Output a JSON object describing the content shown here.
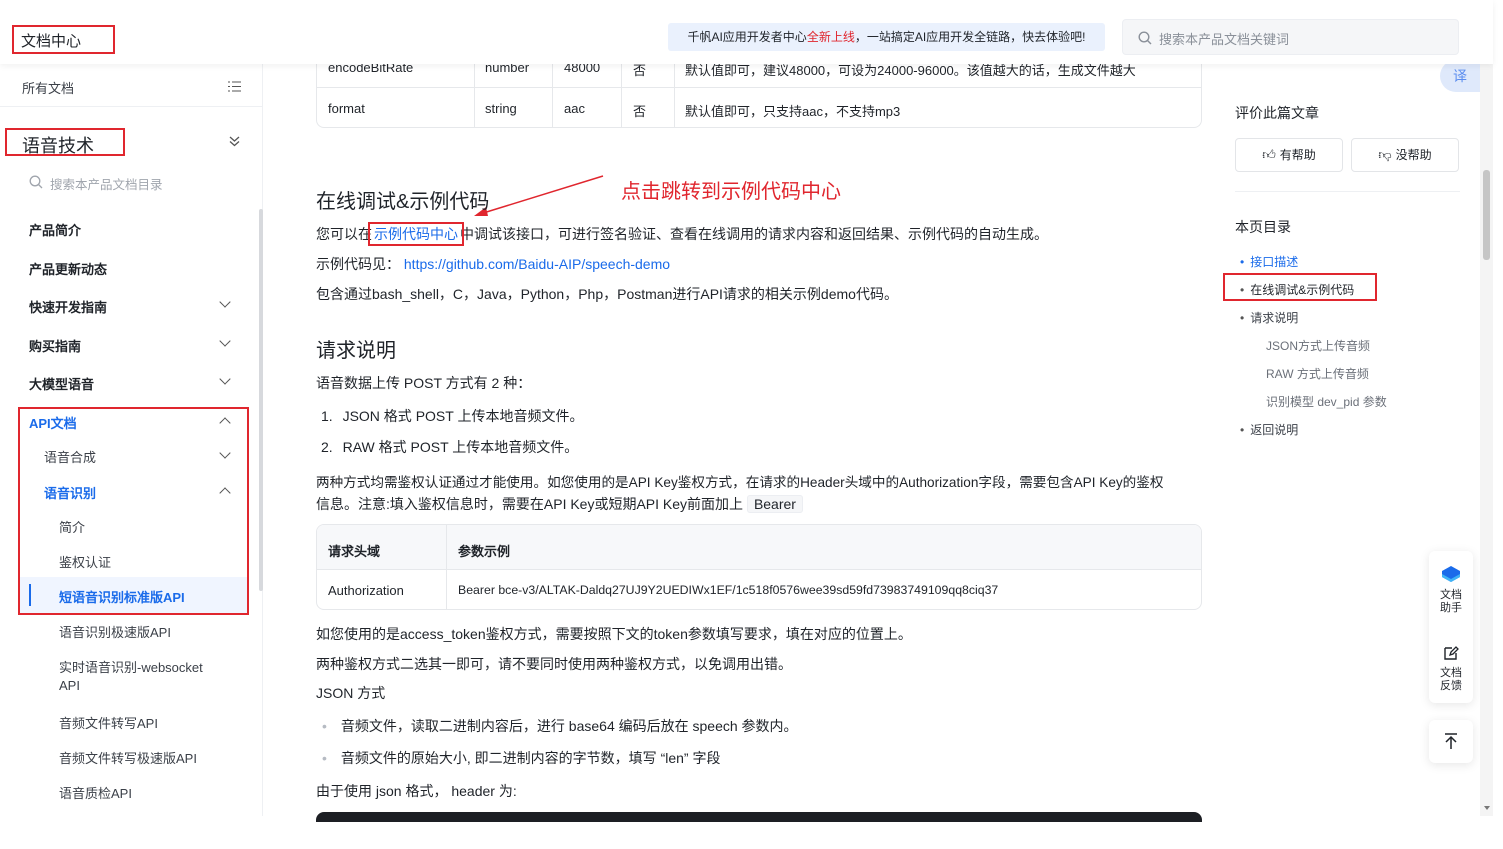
{
  "header": {
    "logo_text": "文档中心",
    "banner_prefix": "千帆AI应用开发者中心",
    "banner_highlight": "全新上线",
    "banner_suffix": "，一站搞定AI应用开发全链路，快去体验吧!",
    "search_placeholder": "搜索本产品文档关键词"
  },
  "sidebar": {
    "all_docs": "所有文档",
    "product_title": "语音技术",
    "search_placeholder": "搜索本产品文档目录",
    "items": [
      {
        "label": "产品简介"
      },
      {
        "label": "产品更新动态"
      },
      {
        "label": "快速开发指南"
      },
      {
        "label": "购买指南"
      },
      {
        "label": "大模型语音"
      },
      {
        "label": "API文档"
      }
    ],
    "sub_items": [
      {
        "label": "语音合成"
      },
      {
        "label": "语音识别"
      }
    ],
    "leaf_items": [
      {
        "label": "简介"
      },
      {
        "label": "鉴权认证"
      },
      {
        "label": "短语音识别标准版API"
      },
      {
        "label": "语音识别极速版API"
      },
      {
        "label": "实时语音识别-websocket"
      },
      {
        "label": "API"
      },
      {
        "label": "音频文件转写API"
      },
      {
        "label": "音频文件转写极速版API"
      },
      {
        "label": "语音质检API"
      }
    ]
  },
  "main": {
    "param_table": {
      "rows": [
        {
          "name": "encodeBitRate",
          "type": "number",
          "value": "48000",
          "required": "否",
          "desc": "默认值即可，建议48000，可设为24000-96000。该值越大的话，生成文件越大"
        },
        {
          "name": "format",
          "type": "string",
          "value": "aac",
          "required": "否",
          "desc": "默认值即可，只支持aac，不支持mp3"
        }
      ]
    },
    "annotation": "点击跳转到示例代码中心",
    "section1_title": "在线调试&示例代码",
    "s1_p1_prefix": "您可以在",
    "s1_p1_link": "示例代码中心",
    "s1_p1_suffix": "中调试该接口，可进行签名验证、查看在线调用的请求内容和返回结果、示例代码的自动生成。",
    "s1_p2_prefix": "示例代码见：",
    "s1_p2_link": "https://github.com/Baidu-AIP/speech-demo",
    "s1_p3": "包含通过bash_shell，C，Java，Python，Php，Postman进行API请求的相关示例demo代码。",
    "section2_title": "请求说明",
    "s2_p1": "语音数据上传 POST 方式有 2 种：",
    "s2_list": [
      "JSON 格式 POST 上传本地音频文件。",
      "RAW 格式 POST 上传本地音频文件。"
    ],
    "s2_list_nums": [
      "1.",
      "2."
    ],
    "s2_p2_line1": "两种方式均需鉴权认证通过才能使用。如您使用的是API Key鉴权方式，在请求的Header头域中的Authorization字段，需要包含API Key的鉴权",
    "s2_p2_line2": "信息。注意:填入鉴权信息时，需要在API Key或短期API Key前面加上",
    "s2_p2_code": "Bearer",
    "auth_table": {
      "headers": [
        "请求头域",
        "参数示例"
      ],
      "row": [
        "Authorization",
        "Bearer bce-v3/ALTAK-Daldq27UJ9Y2UEDIWx1EF/1c518f0576wee39sd59fd73983749109qq8ciq37"
      ]
    },
    "s2_p3": "如您使用的是access_token鉴权方式，需要按照下文的token参数填写要求，填在对应的位置上。",
    "s2_p4": "两种鉴权方式二选其一即可，请不要同时使用两种鉴权方式，以免调用出错。",
    "s2_p5": "JSON 方式",
    "bullets": [
      "音频文件，读取二进制内容后，进行 base64 编码后放在 speech 参数内。",
      "音频文件的原始大小, 即二进制内容的字节数，填写 “len” 字段"
    ],
    "s2_p6": "由于使用 json 格式， header 为:"
  },
  "right": {
    "translate": "译",
    "rate_title": "评价此篇文章",
    "helpful": "有帮助",
    "not_helpful": "没帮助",
    "toc_title": "本页目录",
    "toc": [
      {
        "label": "接口描述"
      },
      {
        "label": "在线调试&示例代码"
      },
      {
        "label": "请求说明"
      },
      {
        "label": "JSON方式上传音频"
      },
      {
        "label": "RAW 方式上传音频"
      },
      {
        "label": "识别模型 dev_pid 参数"
      },
      {
        "label": "返回说明"
      }
    ],
    "doc_assistant": [
      "文档",
      "助手"
    ],
    "doc_feedback": [
      "文档",
      "反馈"
    ]
  },
  "colors": {
    "accent": "#1a6bea",
    "annotation_red": "#e0262e"
  }
}
